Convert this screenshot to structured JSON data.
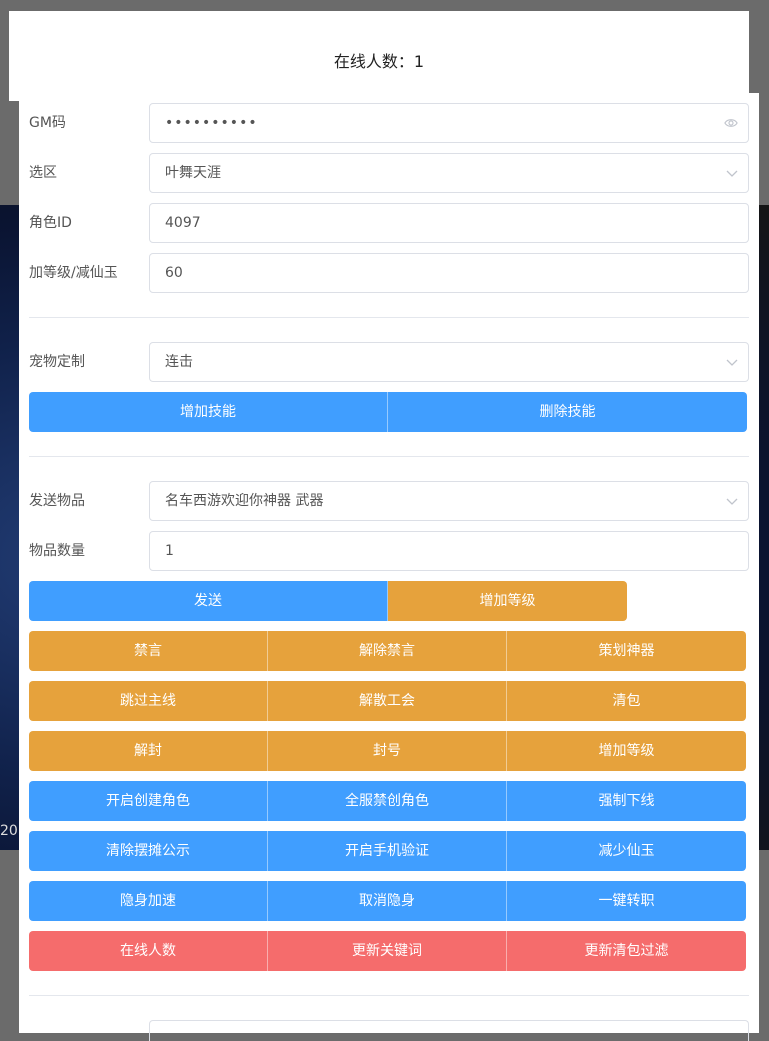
{
  "header": {
    "online_count_label": "在线人数：1"
  },
  "form": {
    "gm_code": {
      "label": "GM码",
      "value": "••••••••••"
    },
    "server": {
      "label": "选区",
      "value": "叶舞天涯"
    },
    "role_id": {
      "label": "角色ID",
      "value": "4097"
    },
    "level_jade": {
      "label": "加等级/减仙玉",
      "value": "60"
    },
    "pet": {
      "label": "宠物定制",
      "value": "连击"
    },
    "item": {
      "label": "发送物品",
      "value": "名车西游欢迎你神器 武器"
    },
    "item_qty": {
      "label": "物品数量",
      "value": "1"
    }
  },
  "pet_buttons": [
    "增加技能",
    "删除技能"
  ],
  "send_buttons": [
    "发送",
    "增加等级"
  ],
  "grid_buttons": [
    [
      "禁言",
      "解除禁言",
      "策划神器"
    ],
    [
      "跳过主线",
      "解散工会",
      "清包"
    ],
    [
      "解封",
      "封号",
      "增加等级"
    ],
    [
      "开启创建角色",
      "全服禁创角色",
      "强制下线"
    ],
    [
      "清除摆摊公示",
      "开启手机验证",
      "减少仙玉"
    ],
    [
      "隐身加速",
      "取消隐身",
      "一键转职"
    ],
    [
      "在线人数",
      "更新关键词",
      "更新清包过滤"
    ]
  ],
  "colors": {
    "primary": "#409eff",
    "warning": "#e6a23c",
    "danger": "#f56c6c"
  },
  "background_text": "20"
}
